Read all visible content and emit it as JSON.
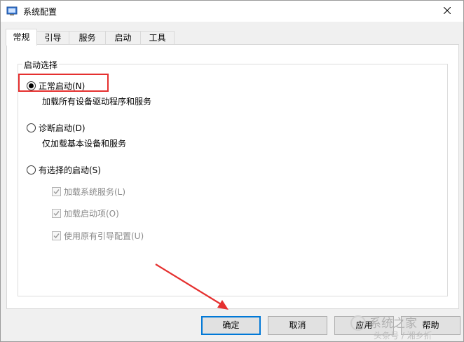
{
  "window": {
    "title": "系统配置",
    "app_icon": "msconfig-icon",
    "close_glyph": "✕"
  },
  "tabs": [
    {
      "label": "常规",
      "active": true
    },
    {
      "label": "引导",
      "active": false
    },
    {
      "label": "服务",
      "active": false
    },
    {
      "label": "启动",
      "active": false
    },
    {
      "label": "工具",
      "active": false
    }
  ],
  "startup": {
    "group_label": "启动选择",
    "normal": {
      "label": "正常启动(N)",
      "description": "加载所有设备驱动程序和服务",
      "checked": true
    },
    "diagnostic": {
      "label": "诊断启动(D)",
      "description": "仅加载基本设备和服务",
      "checked": false
    },
    "selective": {
      "label": "有选择的启动(S)",
      "checked": false,
      "options": [
        {
          "label": "加载系统服务(L)",
          "checked": true,
          "enabled": false
        },
        {
          "label": "加载启动项(O)",
          "checked": true,
          "enabled": false
        },
        {
          "label": "使用原有引导配置(U)",
          "checked": true,
          "enabled": false
        }
      ]
    }
  },
  "buttons": {
    "ok": "确定",
    "cancel": "取消",
    "apply": "应用",
    "help": "帮助"
  },
  "annotation": {
    "highlight_color": "#e5302f",
    "arrow_color": "#e5302f"
  },
  "watermark": {
    "text": "系统之家",
    "subtext": "头条号 / 湘乡折"
  },
  "colors": {
    "accent": "#0078d7",
    "window_bg": "#f0f0f0"
  }
}
